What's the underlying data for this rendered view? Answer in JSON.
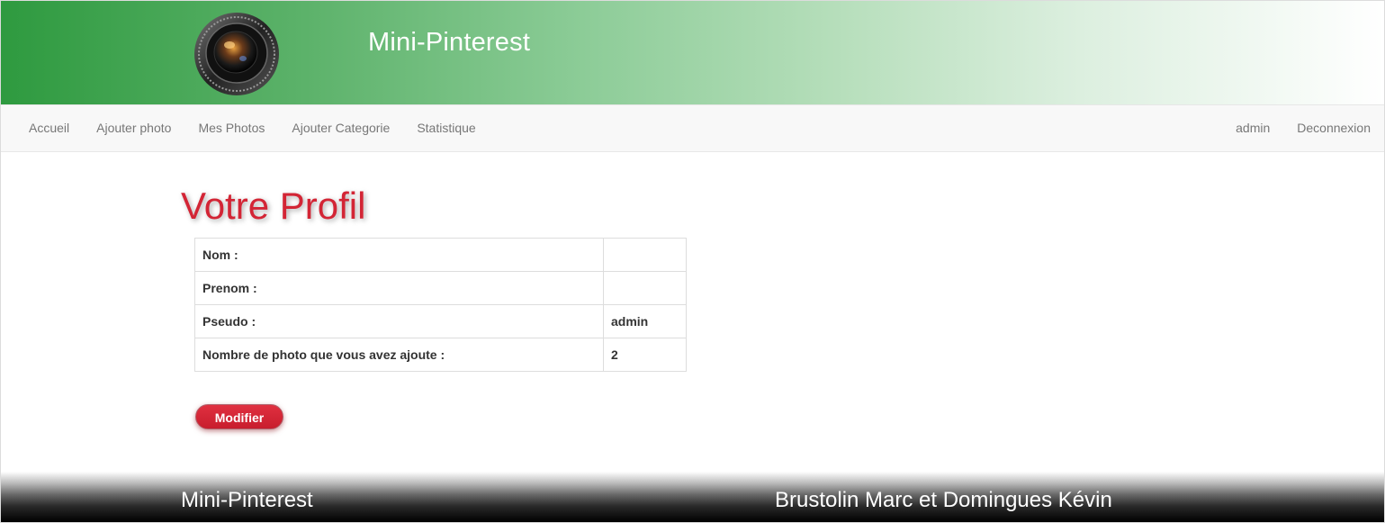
{
  "header": {
    "site_title": "Mini-Pinterest",
    "logo_icon": "camera-lens-icon"
  },
  "navbar": {
    "left_items": [
      "Accueil",
      "Ajouter photo",
      "Mes Photos",
      "Ajouter Categorie",
      "Statistique"
    ],
    "right_items": [
      "admin",
      "Deconnexion"
    ]
  },
  "profile": {
    "title": "Votre Profil",
    "rows": [
      {
        "label": "Nom :",
        "value": ""
      },
      {
        "label": "Prenom :",
        "value": ""
      },
      {
        "label": "Pseudo :",
        "value": "admin"
      },
      {
        "label": "Nombre de photo que vous avez ajoute :",
        "value": "2"
      }
    ],
    "modify_label": "Modifier"
  },
  "footer": {
    "left_text": "Mini-Pinterest",
    "right_text": "Brustolin Marc et Domingues Kévin"
  },
  "colors": {
    "accent_red": "#d32535",
    "header_green": "#2e9a3f"
  }
}
